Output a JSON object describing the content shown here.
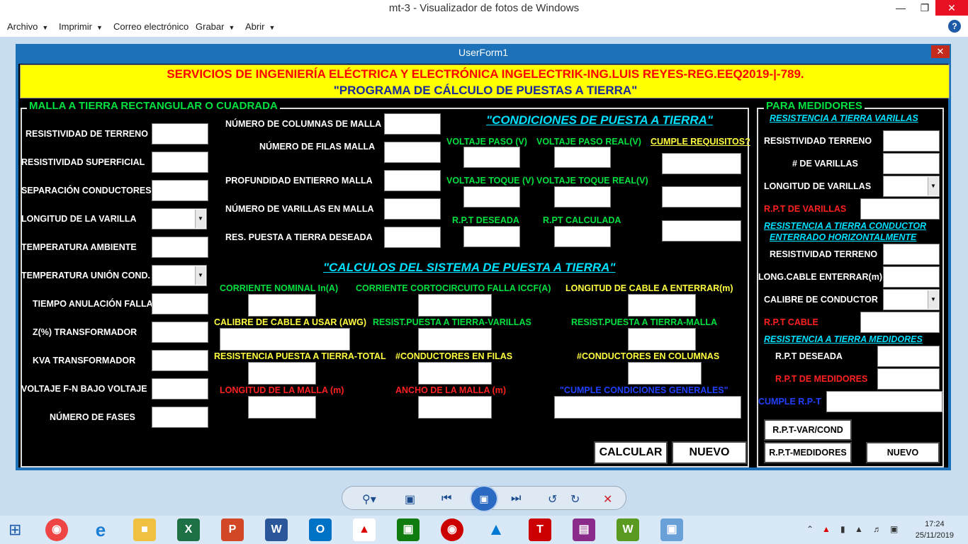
{
  "window": {
    "title": "mt-3 - Visualizador de fotos de Windows"
  },
  "menu": {
    "archivo": "Archivo",
    "imprimir": "Imprimir",
    "correo": "Correo electrónico",
    "grabar": "Grabar",
    "abrir": "Abrir"
  },
  "form": {
    "title": "UserForm1",
    "header_line1": "SERVICIOS DE INGENIERÍA ELÉCTRICA Y ELECTRÓNICA INGELECTRIK-ING.LUIS REYES-REG.EEQ2019-|-789.",
    "header_line2": "\"PROGRAMA DE CÁLCULO DE PUESTAS A TIERRA\"",
    "malla": {
      "title": "MALLA A TIERRA RECTANGULAR O CUADRADA",
      "left_labels": [
        "RESISTIVIDAD DE TERRENO",
        "RESISTIVIDAD SUPERFICIAL",
        "SEPARACIÓN CONDUCTORES",
        "LONGITUD DE LA VARILLA",
        "TEMPERATURA AMBIENTE",
        "TEMPERATURA UNIÓN COND.",
        "TIEMPO ANULACIÓN FALLA",
        "Z(%) TRANSFORMADOR",
        "KVA TRANSFORMADOR",
        "VOLTAJE F-N BAJO VOLTAJE",
        "NÚMERO DE FASES"
      ],
      "mid_labels": [
        "NÚMERO DE COLUMNAS DE MALLA",
        "NÚMERO DE FILAS MALLA",
        "PROFUNDIDAD ENTIERRO MALLA",
        "NÚMERO DE VARILLAS EN MALLA",
        "RES. PUESTA A TIERRA DESEADA"
      ],
      "cond_title": "\"CONDICIONES DE PUESTA A TIERRA\"",
      "voltaje_paso": "VOLTAJE PASO (V)",
      "voltaje_paso_real": "VOLTAJE PASO REAL(V)",
      "cumple_requisitos": "CUMPLE REQUISITOS?",
      "voltaje_toque": "VOLTAJE TOQUE (V)",
      "voltaje_toque_real": "VOLTAJE TOQUE REAL(V)",
      "rpt_deseada": "R.P.T DESEADA",
      "rpt_calculada": "R.PT CALCULADA",
      "calc_title": "\"CALCULOS DEL SISTEMA DE PUESTA A TIERRA\"",
      "corriente_nominal": "CORRIENTE NOMINAL In(A)",
      "corriente_cc": "CORRIENTE CORTOCIRCUITO FALLA ICCF(A)",
      "longitud_cable": "LONGITUD DE CABLE A ENTERRAR(m)",
      "calibre_cable": "CALIBRE DE CABLE A USAR (AWG)",
      "resist_varillas": "RESIST.PUESTA A TIERRA-VARILLAS",
      "resist_malla": "RESIST.PUESTA A TIERRA-MALLA",
      "resist_total": "RESISTENCIA PUESTA A TIERRA-TOTAL",
      "cond_filas": "#CONDUCTORES EN FILAS",
      "cond_columnas": "#CONDUCTORES EN COLUMNAS",
      "longitud_malla": "LONGITUD DE LA MALLA (m)",
      "ancho_malla": "ANCHO DE LA MALLA (m)",
      "cumple_generales": "\"CUMPLE CONDICIONES GENERALES\"",
      "calcular_button": "CALCULAR",
      "nuevo_button": "NUEVO"
    },
    "medidores": {
      "title": "PARA MEDIDORES",
      "res_varillas_title": "RESISTENCIA A TIERRA VARILLAS",
      "resistividad_terreno": "RESISTIVIDAD TERRENO",
      "num_varillas": "# DE VARILLAS",
      "longitud_varillas": "LONGITUD DE VARILLAS",
      "rpt_varillas": "R.P.T DE VARILLAS",
      "res_conductor_title1": "RESISTENCIA A TIERRA CONDUCTOR",
      "res_conductor_title2": "ENTERRADO HORIZONTALMENTE",
      "resistividad_terreno2": "RESISTIVIDAD TERRENO",
      "long_cable": "LONG.CABLE ENTERRAR(m)",
      "calibre_conductor": "CALIBRE DE CONDUCTOR",
      "rpt_cable": "R.P.T CABLE",
      "res_medidores_title": "RESISTENCIA A TIERRA MEDIDORES",
      "rpt_deseada": "R.P.T DESEADA",
      "rpt_medidores": "R.P.T DE MEDIDORES",
      "cumple_rpt": "CUMPLE R.P-T",
      "rpt_var_cond_button": "R.P.T-VAR/COND",
      "rpt_medidores_button": "R.P.T-MEDIDORES",
      "nuevo_button": "NUEVO"
    }
  },
  "taskbar": {
    "time": "17:24",
    "date": "25/11/2019"
  }
}
